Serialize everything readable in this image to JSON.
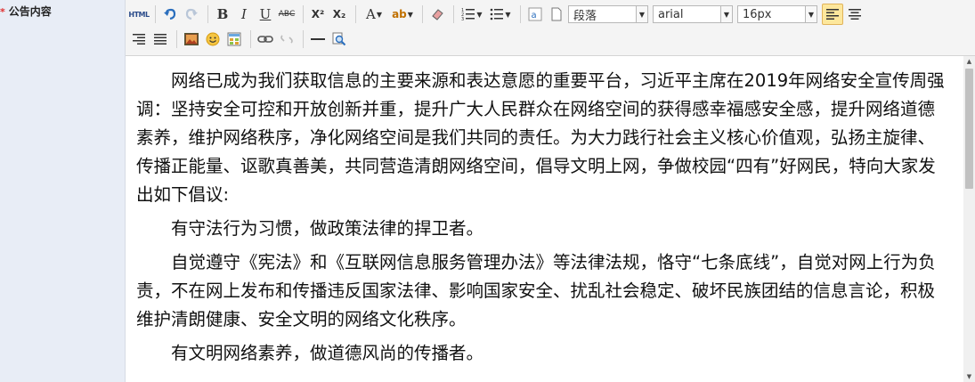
{
  "field": {
    "required_mark": "*",
    "label": "公告内容"
  },
  "toolbar": {
    "html_label": "HTML",
    "bold": "B",
    "italic": "I",
    "underline": "U",
    "strikethrough": "ABC",
    "superscript": "X²",
    "subscript": "X₂",
    "font_color": "A",
    "highlight": "ab",
    "paragraph_format": "段落",
    "font_family": "arial",
    "font_size": "16px"
  },
  "content": {
    "paragraphs": [
      "网络已成为我们获取信息的主要来源和表达意愿的重要平台，习近平主席在2019年网络安全宣传周强调：坚持安全可控和开放创新并重，提升广大人民群众在网络空间的获得感幸福感安全感，提升网络道德素养，维护网络秩序，净化网络空间是我们共同的责任。为大力践行社会主义核心价值观，弘扬主旋律、传播正能量、讴歌真善美，共同营造清朗网络空间，倡导文明上网，争做校园“四有”好网民，特向大家发出如下倡议:",
      "有守法行为习惯，做政策法律的捍卫者。",
      "自觉遵守《宪法》和《互联网信息服务管理办法》等法律法规，恪守“七条底线”，自觉对网上行为负责，不在网上发布和传播违反国家法律、影响国家安全、扰乱社会稳定、破坏民族团结的信息言论，积极维护清朗健康、安全文明的网络文化秩序。",
      "有文明网络素养，做道德风尚的传播者。"
    ]
  },
  "colors": {
    "sidebar_bg": "#e8edf6",
    "toolbar_bg": "#f4f4f4",
    "active_btn": "#fde79c",
    "icon_blue": "#2a6ebd"
  }
}
